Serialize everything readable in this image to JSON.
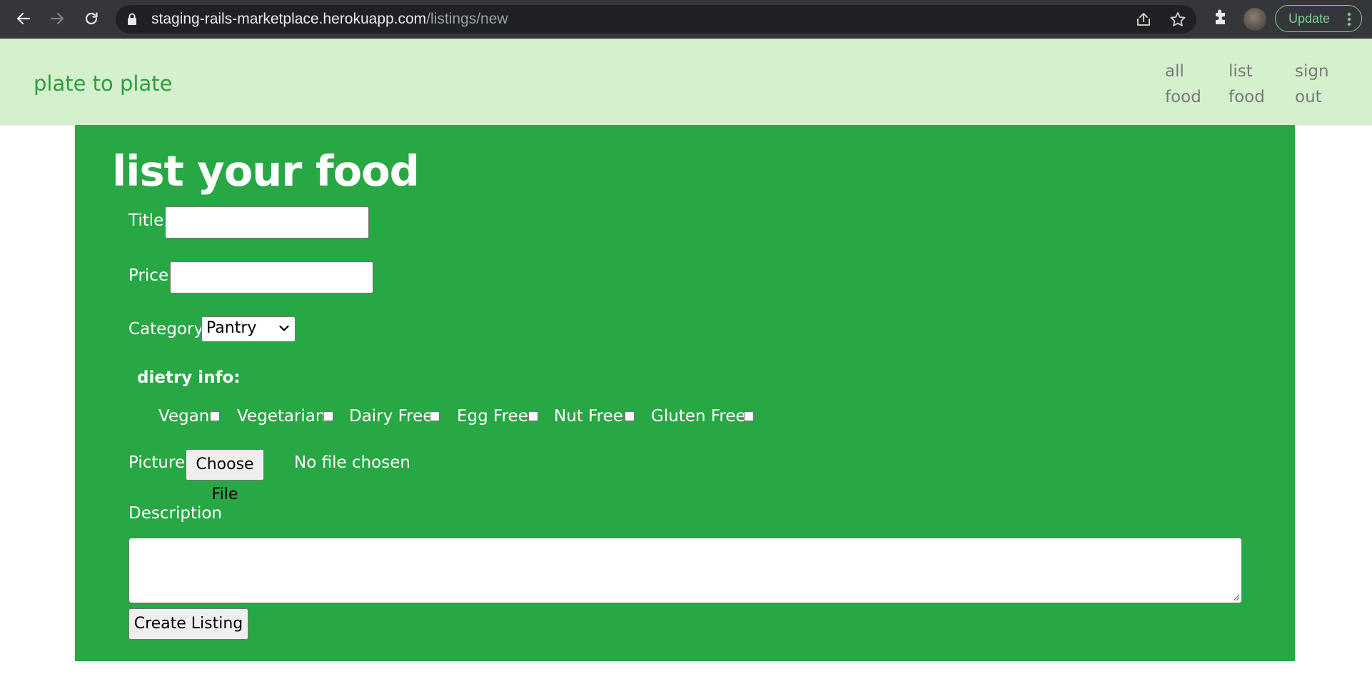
{
  "browser": {
    "url_host": "staging-rails-marketplace.herokuapp.com",
    "url_path": "/listings/new",
    "update_label": "Update"
  },
  "site": {
    "brand": "plate to plate",
    "nav": [
      {
        "line1": "all",
        "line2": "food"
      },
      {
        "line1": "list",
        "line2": "food"
      },
      {
        "line1": "sign",
        "line2": "out"
      }
    ]
  },
  "form": {
    "heading": "list your food",
    "title_label": "Title",
    "title_value": "",
    "price_label": "Price",
    "price_value": "",
    "category_label": "Category",
    "category_selected": "Pantry",
    "dietary_heading": "dietry info:",
    "dietary_options": [
      {
        "label": "Vegan",
        "checked": false
      },
      {
        "label": "Vegetarian",
        "checked": false
      },
      {
        "label": "Dairy Free",
        "checked": false
      },
      {
        "label": "Egg Free",
        "checked": false
      },
      {
        "label": "Nut Free",
        "checked": false
      },
      {
        "label": "Gluten Free",
        "checked": false
      }
    ],
    "picture_label": "Picture",
    "file_button_label": "Choose File",
    "file_status": "No file chosen",
    "description_label": "Description",
    "description_value": "",
    "submit_label": "Create Listing"
  },
  "colors": {
    "header_bg": "#d4f0cc",
    "brand_green": "#2f9f43",
    "panel_green": "#28a745"
  }
}
